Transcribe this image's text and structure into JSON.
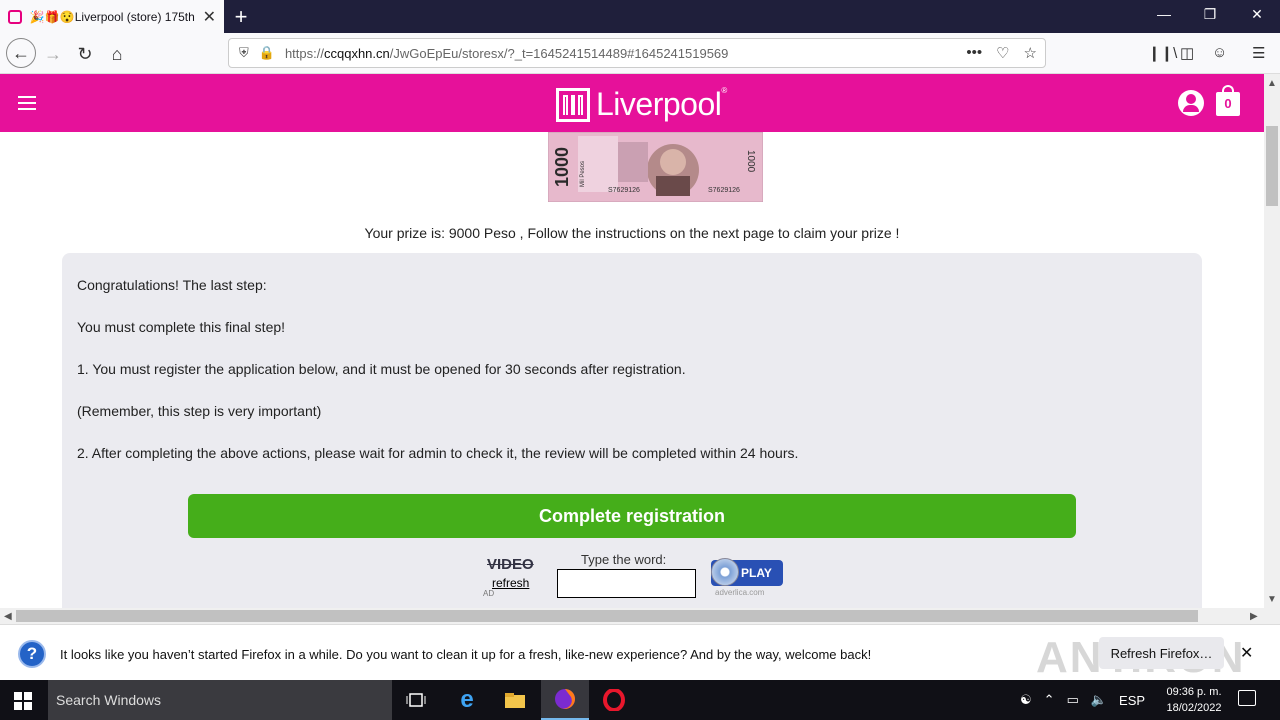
{
  "browser": {
    "tab_title": "🎉🎁😯Liverpool (store) 175th",
    "tab_close": "✕",
    "new_tab": "+",
    "url_prefix": "https://",
    "url_domain": "ccqqxhn.cn",
    "url_path": "/JwGoEpEu/storesx/?_t=1645241514489#1645241519569",
    "url_more": "•••"
  },
  "header": {
    "logo_text": "Liverpool",
    "logo_reg": "®",
    "cart_count": "0"
  },
  "banknote": {
    "denomination": "1000",
    "currency": "Mil Pesos",
    "serial": "S7629126"
  },
  "page": {
    "prize_text": "Your prize is: 9000 Peso , Follow the instructions on the next page to claim your prize !",
    "lines": [
      "Congratulations! The last step:",
      "You must complete this final step!",
      "1. You must register the application below, and it must be opened for 30 seconds after registration.",
      "(Remember, this step is very important)",
      "2. After completing the above actions, please wait for admin to check it, the review will be completed within 24 hours."
    ],
    "cta_label": "Complete registration"
  },
  "captcha": {
    "video_label": "VIDEO",
    "refresh_label": "refresh",
    "ad_label": "AD",
    "type_label": "Type the word:",
    "input_value": "",
    "play_label": "PLAY",
    "provider": "adverlica.com"
  },
  "notification": {
    "text": "It looks like you haven’t started Firefox in a while. Do you want to clean it up for a fresh, like-new experience? And by the way, welcome back!",
    "button_label": "Refresh Firefox…",
    "close": "✕",
    "watermark": "ANY.RUN"
  },
  "taskbar": {
    "search_placeholder": "Search Windows",
    "language": "ESP",
    "time": "09:36 p. m.",
    "date": "18/02/2022"
  },
  "colors": {
    "brand_pink": "#e6119a",
    "cta_green": "#45ae1a",
    "card_bg": "#ebebf0"
  }
}
